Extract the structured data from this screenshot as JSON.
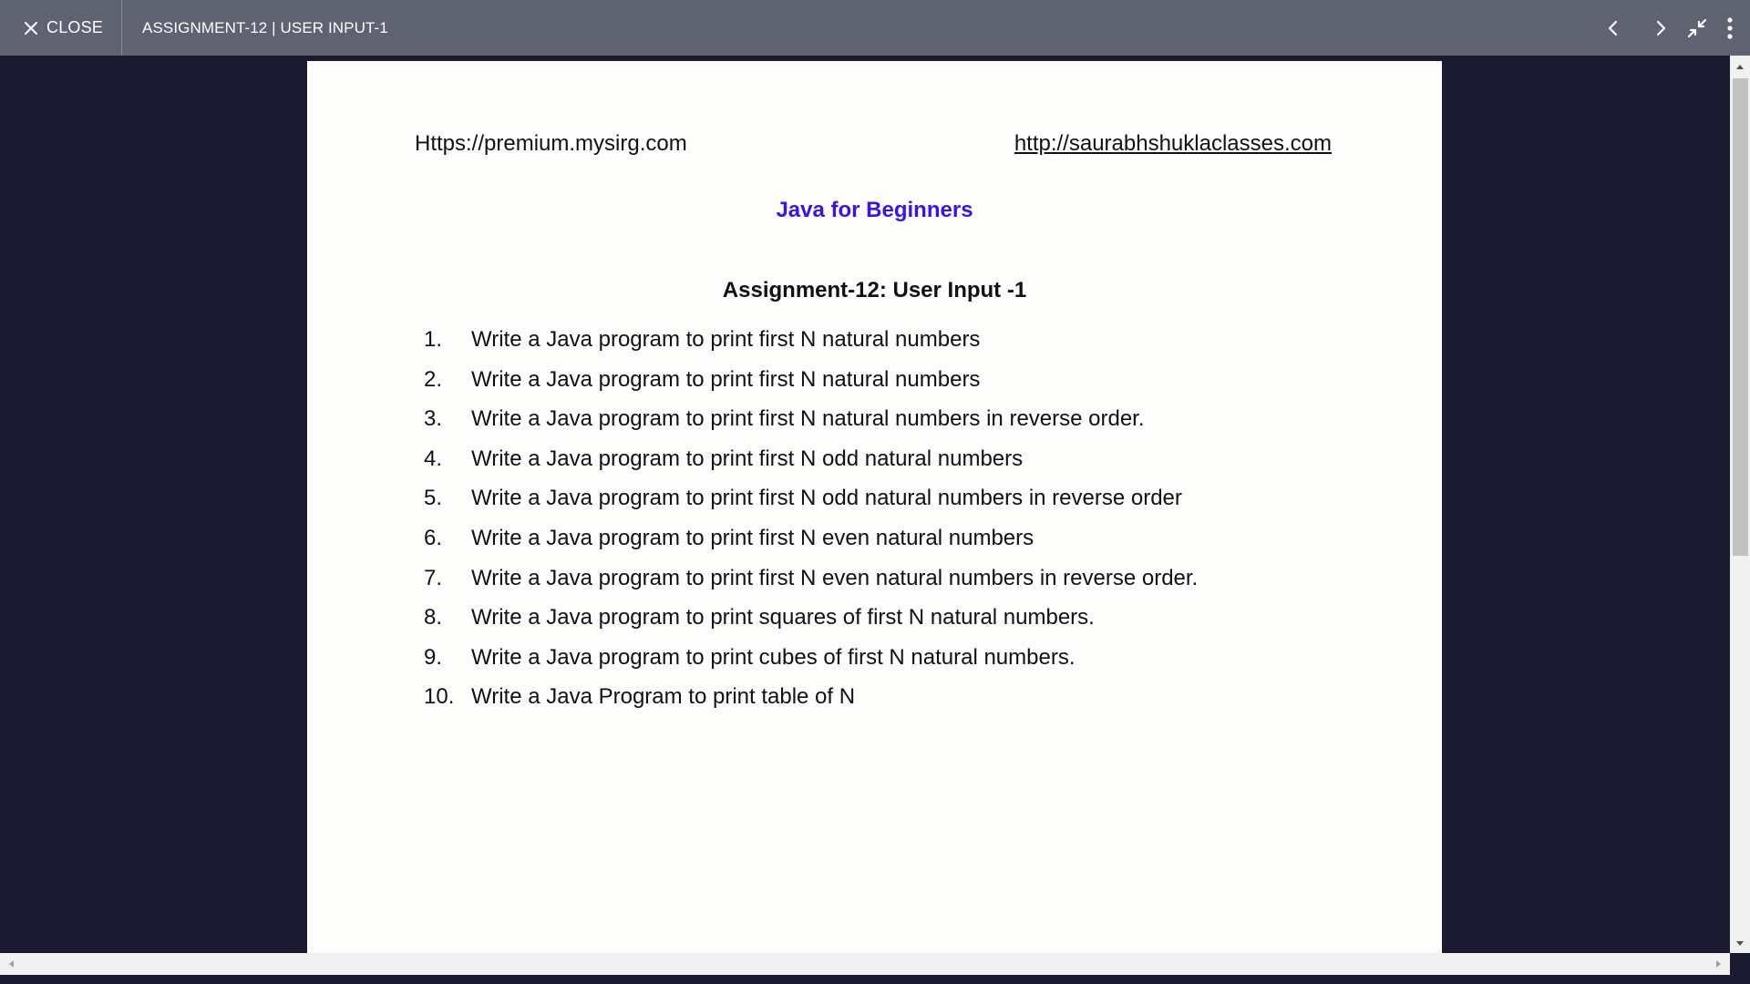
{
  "topbar": {
    "close_label": "CLOSE",
    "document_title": "ASSIGNMENT-12 | USER INPUT-1",
    "icons": [
      "chevron-left-icon",
      "chevron-right-icon",
      "collapse-icon",
      "more-vert-icon"
    ]
  },
  "document": {
    "site_left": "Https://premium.mysirg.com",
    "site_right": "http://saurabhshuklaclasses.com",
    "course_title": "Java for Beginners",
    "assignment_title": "Assignment-12: User Input -1",
    "tasks": [
      {
        "num": "1.",
        "text": "Write a Java program to print first N natural numbers"
      },
      {
        "num": "2.",
        "text": "Write a Java program to print first N natural numbers"
      },
      {
        "num": "3.",
        "text": "Write a Java program to print first N natural numbers in reverse order."
      },
      {
        "num": "4.",
        "text": "Write a Java program to print first N odd natural numbers"
      },
      {
        "num": "5.",
        "text": "Write a Java program to print first N odd natural numbers in reverse order"
      },
      {
        "num": "6.",
        "text": "Write a Java program to print first N even natural numbers"
      },
      {
        "num": "7.",
        "text": "Write a Java program to print first N even natural numbers in reverse order."
      },
      {
        "num": "8.",
        "text": "Write a Java program to print squares of first N natural numbers."
      },
      {
        "num": "9.",
        "text": "Write a Java program to print cubes of first N natural numbers."
      },
      {
        "num": "10.",
        "text": "Write a Java Program to print table of N"
      }
    ]
  },
  "colors": {
    "topbar_bg": "#5f6271",
    "viewer_bg": "#1a1b31",
    "page_bg": "#fdfdfc",
    "course_title": "#3a12f0"
  }
}
